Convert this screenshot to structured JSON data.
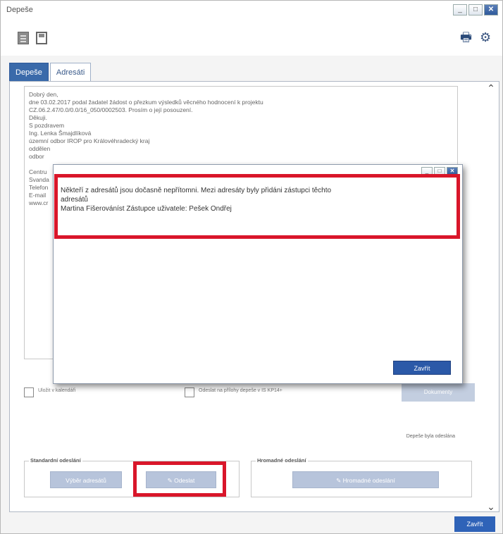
{
  "window": {
    "title": "Depeše"
  },
  "toolbar": {
    "doc_icon": "document-icon",
    "save_icon": "save-icon",
    "print_icon": "printer-icon",
    "settings_icon": "gear-icon"
  },
  "tabs": [
    {
      "label": "Depeše",
      "active": true
    },
    {
      "label": "Adresáti",
      "active": false
    }
  ],
  "message": {
    "lines": [
      "Dobrý den,",
      "dne 03.02.2017 podal žadatel žádost o přezkum výsledků věcného hodnocení k projektu",
      "CZ.06.2.47/0.0/0.0/16_050/0002503. Prosím o její posouzení.",
      "Děkuji.",
      "S pozdravem",
      "Ing. Lenka Šmajdlíková",
      "územní odbor IROP pro Královéhradecký kraj",
      "oddělen",
      "odbor",
      "",
      "Centru",
      "Svanda",
      "Telefon",
      "E-mail",
      "www.cr"
    ]
  },
  "options": {
    "checkbox1_label": "Uložit v kalendáři",
    "checkbox2_label": "Odeslat na přílohy depeše v IS KP14+",
    "document_button": "Dokumenty"
  },
  "status": {
    "sent_text": "Depeše byla odeslána"
  },
  "standard_sending": {
    "legend": "Standardní odeslání",
    "select_recipients": "Výběr adresátů",
    "send_button": "Odeslat"
  },
  "bulk_sending": {
    "legend": "Hromadné odeslání",
    "bulk_send_button": "Hromadné odeslání"
  },
  "close_button": "Zavřít",
  "modal": {
    "line1": "Někteří z adresátů jsou dočasně nepřítomni. Mezi adresáty byly přidáni zástupci těchto",
    "line2": "adresátů",
    "line3": "Martina Fišerováníst Zástupce uživatele: Pešek Ondřej",
    "close_button": "Zavřít"
  },
  "colors": {
    "highlight": "#d9162a",
    "primary_button": "#2f63b8",
    "disabled_button": "#b7c4db"
  }
}
